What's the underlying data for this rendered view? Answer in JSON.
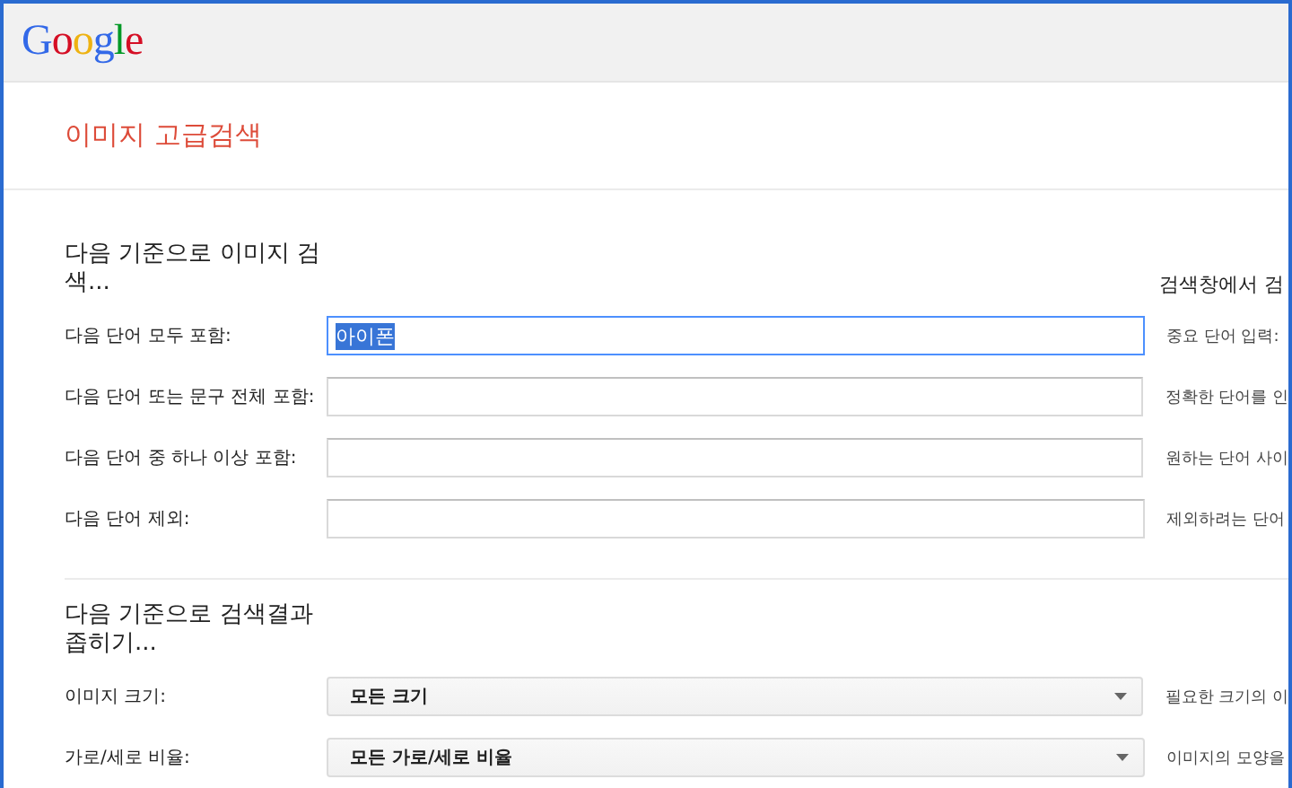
{
  "header": {
    "logo": "Google"
  },
  "page_title": "이미지 고급검색",
  "sections": [
    {
      "heading": "다음 기준으로 이미지 검색...",
      "side_heading": "검색창에서 검",
      "rows": [
        {
          "kind": "input",
          "label": "다음 단어 모두 포함:",
          "value": "아이폰",
          "focused": true,
          "hint": "중요 단어 입력:"
        },
        {
          "kind": "input",
          "label": "다음 단어 또는 문구 전체 포함:",
          "value": "",
          "focused": false,
          "hint": "정확한 단어를 인"
        },
        {
          "kind": "input",
          "label": "다음 단어 중 하나 이상 포함:",
          "value": "",
          "focused": false,
          "hint": "원하는 단어 사이"
        },
        {
          "kind": "input",
          "label": "다음 단어 제외:",
          "value": "",
          "focused": false,
          "hint": "제외하려는 단어"
        }
      ]
    },
    {
      "heading": "다음 기준으로 검색결과 좁히기...",
      "rows": [
        {
          "kind": "select",
          "label": "이미지 크기:",
          "value": "모든 크기",
          "hint": "필요한 크기의 이"
        },
        {
          "kind": "select",
          "label": "가로/세로 비율:",
          "value": "모든 가로/세로 비율",
          "hint": "이미지의 모양을"
        }
      ]
    }
  ]
}
